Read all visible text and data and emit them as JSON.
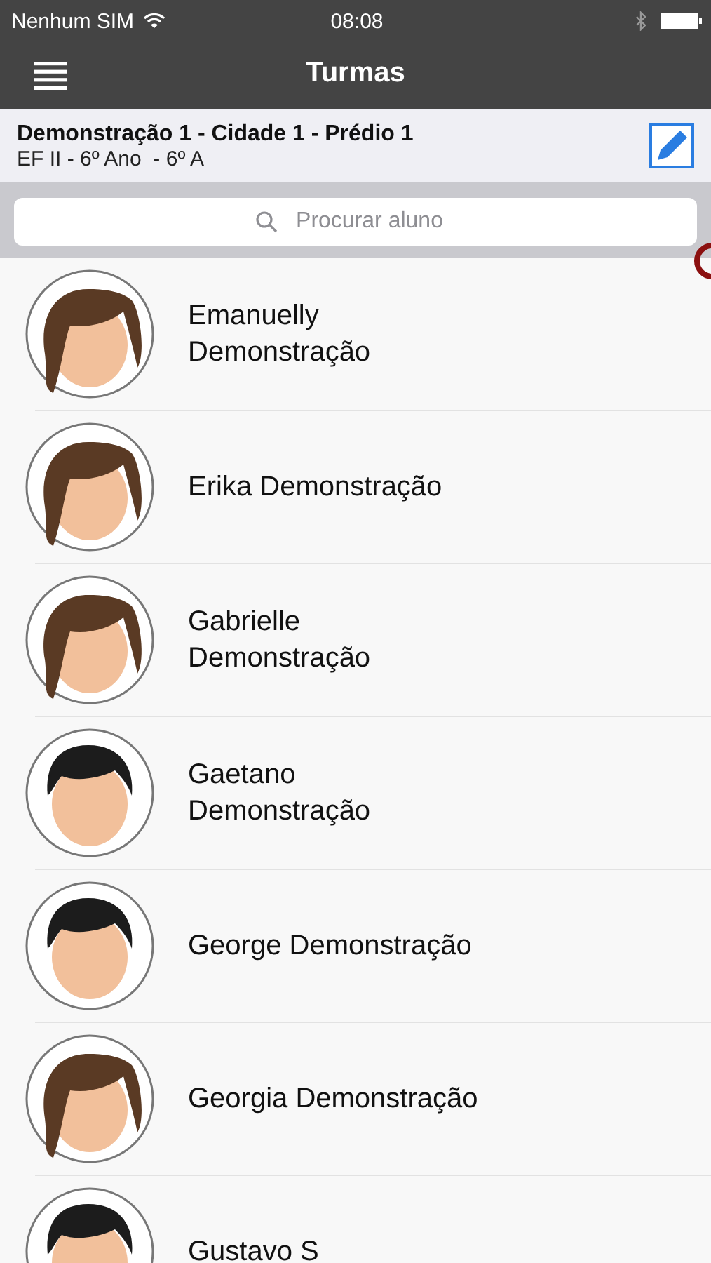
{
  "status_bar": {
    "carrier": "Nenhum SIM",
    "time": "08:08"
  },
  "nav": {
    "title": "Turmas"
  },
  "class_header": {
    "title": "Demonstração 1 - Cidade 1 - Prédio 1",
    "subtitle": "EF II - 6º Ano  - 6º A"
  },
  "search": {
    "placeholder": "Procurar aluno"
  },
  "students": [
    {
      "name": "Emanuelly\nDemonstração",
      "kind": "girl"
    },
    {
      "name": "Erika Demonstração",
      "kind": "girl"
    },
    {
      "name": "Gabrielle\nDemonstração",
      "kind": "girl"
    },
    {
      "name": "Gaetano\nDemonstração",
      "kind": "boy"
    },
    {
      "name": "George Demonstração",
      "kind": "boy"
    },
    {
      "name": "Georgia Demonstração",
      "kind": "girl"
    },
    {
      "name": "Gustavo S",
      "kind": "boy"
    }
  ]
}
